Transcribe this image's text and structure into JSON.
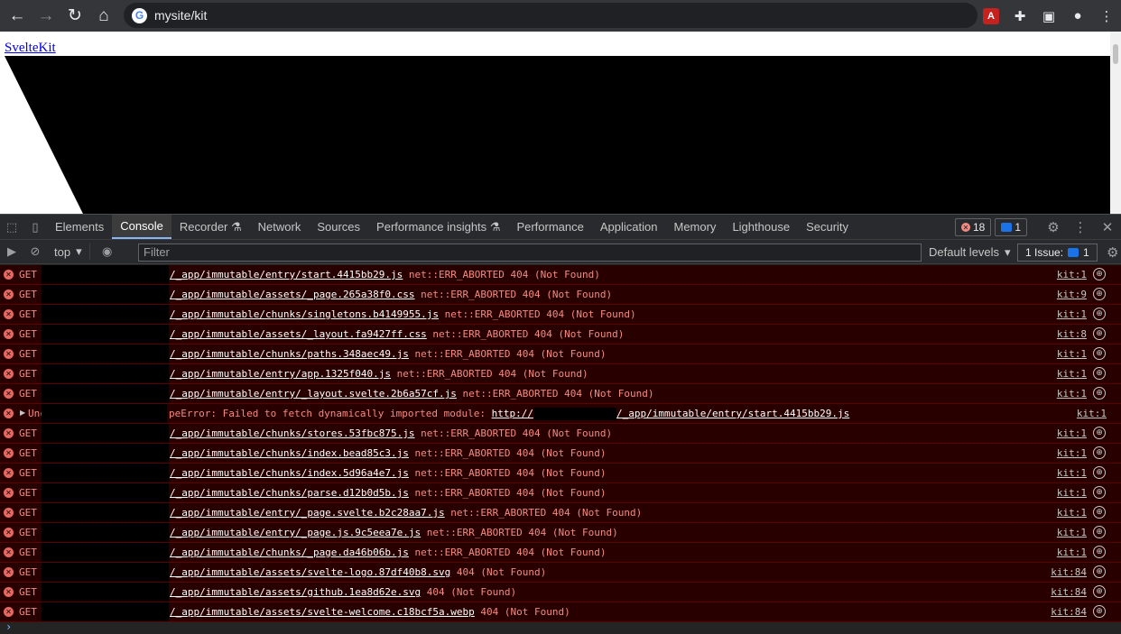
{
  "browser": {
    "url": "mysite/kit",
    "google_glyph": "G",
    "pdf_glyph": "A"
  },
  "page": {
    "broken_image_alt": "SvelteKit"
  },
  "devtools": {
    "tabs": [
      {
        "label": "Elements"
      },
      {
        "label": "Console",
        "active": true
      },
      {
        "label": "Recorder"
      },
      {
        "label": "Network"
      },
      {
        "label": "Sources"
      },
      {
        "label": "Performance insights"
      },
      {
        "label": "Performance"
      },
      {
        "label": "Application"
      },
      {
        "label": "Memory"
      },
      {
        "label": "Lighthouse"
      },
      {
        "label": "Security"
      }
    ],
    "error_count": "18",
    "message_count": "1",
    "console": {
      "context": "top",
      "filter_placeholder": "Filter",
      "levels": "Default levels",
      "issues_label": "1 Issue:",
      "issues_count": "1"
    },
    "entries": [
      {
        "method": "GET",
        "path": "/_app/immutable/entry/start.4415bb29.js",
        "status": "net::ERR_ABORTED 404 (Not Found)",
        "source": "kit:1"
      },
      {
        "method": "GET",
        "path": "/_app/immutable/assets/_page.265a38f0.css",
        "status": "net::ERR_ABORTED 404 (Not Found)",
        "source": "kit:9"
      },
      {
        "method": "GET",
        "path": "/_app/immutable/chunks/singletons.b4149955.js",
        "status": "net::ERR_ABORTED 404 (Not Found)",
        "source": "kit:1"
      },
      {
        "method": "GET",
        "path": "/_app/immutable/assets/_layout.fa9427ff.css",
        "status": "net::ERR_ABORTED 404 (Not Found)",
        "source": "kit:8"
      },
      {
        "method": "GET",
        "path": "/_app/immutable/chunks/paths.348aec49.js",
        "status": "net::ERR_ABORTED 404 (Not Found)",
        "source": "kit:1"
      },
      {
        "method": "GET",
        "path": "/_app/immutable/entry/app.1325f040.js",
        "status": "net::ERR_ABORTED 404 (Not Found)",
        "source": "kit:1"
      },
      {
        "method": "GET",
        "path": "/_app/immutable/entry/_layout.svelte.2b6a57cf.js",
        "status": "net::ERR_ABORTED 404 (Not Found)",
        "source": "kit:1"
      }
    ],
    "exception": {
      "prefix": "Unc",
      "message": "peError: Failed to fetch dynamically imported module: ",
      "url_start": "http://",
      "url_end": "/_app/immutable/entry/start.4415bb29.js",
      "source": "kit:1"
    },
    "entries2": [
      {
        "method": "GET",
        "path": "/_app/immutable/chunks/stores.53fbc875.js",
        "status": "net::ERR_ABORTED 404 (Not Found)",
        "source": "kit:1"
      },
      {
        "method": "GET",
        "path": "/_app/immutable/chunks/index.bead85c3.js",
        "status": "net::ERR_ABORTED 404 (Not Found)",
        "source": "kit:1"
      },
      {
        "method": "GET",
        "path": "/_app/immutable/chunks/index.5d96a4e7.js",
        "status": "net::ERR_ABORTED 404 (Not Found)",
        "source": "kit:1"
      },
      {
        "method": "GET",
        "path": "/_app/immutable/chunks/parse.d12b0d5b.js",
        "status": "net::ERR_ABORTED 404 (Not Found)",
        "source": "kit:1"
      },
      {
        "method": "GET",
        "path": "/_app/immutable/entry/_page.svelte.b2c28aa7.js",
        "status": "net::ERR_ABORTED 404 (Not Found)",
        "source": "kit:1"
      },
      {
        "method": "GET",
        "path": "/_app/immutable/entry/_page.js.9c5eea7e.js",
        "status": "net::ERR_ABORTED 404 (Not Found)",
        "source": "kit:1"
      },
      {
        "method": "GET",
        "path": "/_app/immutable/chunks/_page.da46b06b.js",
        "status": "net::ERR_ABORTED 404 (Not Found)",
        "source": "kit:1"
      },
      {
        "method": "GET",
        "path": "/_app/immutable/assets/svelte-logo.87df40b8.svg",
        "status": "404 (Not Found)",
        "source": "kit:84"
      },
      {
        "method": "GET",
        "path": "/_app/immutable/assets/github.1ea8d62e.svg",
        "status": "404 (Not Found)",
        "source": "kit:84"
      },
      {
        "method": "GET",
        "path": "/_app/immutable/assets/svelte-welcome.c18bcf5a.webp",
        "status": "404 (Not Found)",
        "source": "kit:84"
      }
    ],
    "prompt_glyph": "›"
  }
}
